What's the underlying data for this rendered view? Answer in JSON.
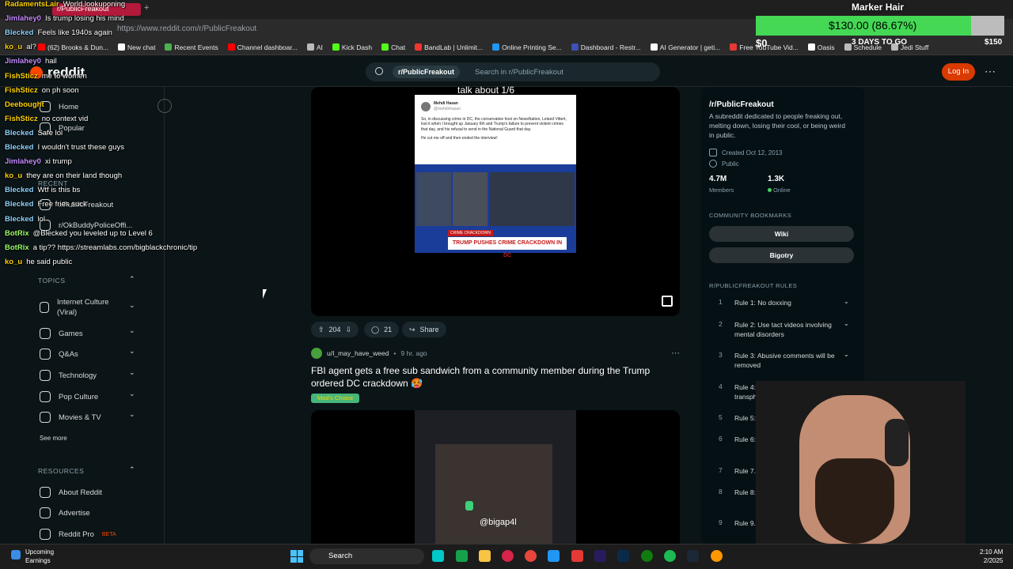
{
  "browser": {
    "tab_title": "r/PublicFreakout",
    "url": "https://www.reddit.com/r/PublicFreakout",
    "bookmarks": [
      {
        "label": "(62) Brooks & Dun...",
        "color": "#ff0000"
      },
      {
        "label": "New chat",
        "color": "#ffffff"
      },
      {
        "label": "Recent Events",
        "color": "#4caf50"
      },
      {
        "label": "Channel dashboar...",
        "color": "#ff0000"
      },
      {
        "label": "AI",
        "color": "#bbbbbb"
      },
      {
        "label": "Kick Dash",
        "color": "#53fc18"
      },
      {
        "label": "Chat",
        "color": "#53fc18"
      },
      {
        "label": "BandLab | Unlimit...",
        "color": "#f0362f"
      },
      {
        "label": "Online Printing Se...",
        "color": "#2196f3"
      },
      {
        "label": "Dashboard - Restr...",
        "color": "#3f51b5"
      },
      {
        "label": "AI Generator | geti...",
        "color": "#ffffff"
      },
      {
        "label": "Free YouTube Vid...",
        "color": "#e53935"
      },
      {
        "label": "Oasis",
        "color": "#ffffff"
      },
      {
        "label": "Schedule",
        "color": "#bbbbbb"
      },
      {
        "label": "Jedi Stuff",
        "color": "#bbbbbb"
      }
    ]
  },
  "header": {
    "logo": "reddit",
    "search_chip": "r/PublicFreakout",
    "search_placeholder": "Search in r/PublicFreakout",
    "login": "Log In"
  },
  "left_nav": {
    "top_items": [
      "Home",
      "Popular"
    ],
    "recent_label": "RECENT",
    "recent_items": [
      "r/PublicFreakout",
      "r/OkBuddyPoliceOffi..."
    ],
    "topics_label": "TOPICS",
    "topics": [
      "Internet Culture (Viral)",
      "Games",
      "Q&As",
      "Technology",
      "Pop Culture",
      "Movies & TV"
    ],
    "see_more": "See more",
    "resources_label": "RESOURCES",
    "resources": [
      "About Reddit",
      "Advertise",
      "Reddit Pro"
    ],
    "reddit_pro_badge": "BETA"
  },
  "post1": {
    "caption": "talk about 1/6",
    "tweet_author": "Mehdi Hasan",
    "tweet_handle": "@mehdirhasan",
    "tweet_text": "So, in discussing crime in DC, the conservative host on NewsNation, Leland Vittert, lost it when I brought up January 6th and Trump's failure to prevent violent crimes that day, and his refusal to send in the National Guard that day.",
    "tweet_text2": "He cut me off and then ended the interview!",
    "tv_banner": "CRIME CRACKDOWN",
    "tv_ticker": "TRUMP PUSHES CRIME CRACKDOWN IN DC",
    "upvotes": "204",
    "comments": "21",
    "share": "Share"
  },
  "post2": {
    "author": "u/I_may_have_weed",
    "time": "9 hr. ago",
    "title": "FBI agent gets a free sub sandwich from a community member during the Trump ordered DC crackdown 🥵",
    "flair": "Mod's Choice",
    "watermark": "@bigap4l"
  },
  "sidebar": {
    "name": "/r/PublicFreakout",
    "description": "A subreddit dedicated to people freaking out, melting down, losing their cool, or being weird in public.",
    "created": "Created Oct 12, 2013",
    "visibility": "Public",
    "members": "4.7M",
    "members_label": "Members",
    "online": "1.3K",
    "online_label": "Online",
    "bookmarks_label": "COMMUNITY BOOKMARKS",
    "bookmarks": [
      "Wiki",
      "Bigotry"
    ],
    "rules_label": "R/PUBLICFREAKOUT RULES",
    "rules": [
      {
        "n": "1",
        "text": "Rule 1: No doxxing"
      },
      {
        "n": "2",
        "text": "Rule 2: Use tact videos involving mental disorders"
      },
      {
        "n": "3",
        "text": "Rule 3: Abusive comments will be removed"
      },
      {
        "n": "4",
        "text": "Rule 4: No racism, sexism, transphobia or bigotry"
      },
      {
        "n": "5",
        "text": "Rule 5: Vid..."
      },
      {
        "n": "6",
        "text": "Rule 6: ... moder..."
      },
      {
        "n": "7",
        "text": "Rule 7..."
      },
      {
        "n": "8",
        "text": "Rule 8: ... death/n..."
      },
      {
        "n": "9",
        "text": "Rule 9... allow..."
      }
    ]
  },
  "stream_goal": {
    "title": "Marker Hair",
    "amount": "$130.00 (86.67%)",
    "progress": 0.8667,
    "min": "$0",
    "days": "3 DAYS TO GO",
    "max": "$150"
  },
  "chat": [
    {
      "user": "RadamentsLair",
      "color": "#ffd400",
      "msg": "World lookuponing"
    },
    {
      "user": "Jimlahey0",
      "color": "#c58cff",
      "msg": "Is trump losing his mind"
    },
    {
      "user": "Blecked",
      "color": "#8fd4ff",
      "msg": "Feels like 1940s again"
    },
    {
      "user": "ko_u",
      "color": "#ffd400",
      "msg": "al?"
    },
    {
      "user": "Jimlahey0",
      "color": "#c58cff",
      "msg": "hail"
    },
    {
      "user": "FishSticz",
      "color": "#ffd400",
      "msg": "me to women"
    },
    {
      "user": "FishSticz",
      "color": "#ffd400",
      "msg": "on ph soon"
    },
    {
      "user": "Deebought",
      "color": "#ffd400",
      "msg": ""
    },
    {
      "user": "FishSticz",
      "color": "#ffd400",
      "msg": "no context vid"
    },
    {
      "user": "Blecked",
      "color": "#8fd4ff",
      "msg": "Safe lol"
    },
    {
      "user": "Blecked",
      "color": "#8fd4ff",
      "msg": "I wouldn't trust these guys"
    },
    {
      "user": "Jimlahey0",
      "color": "#c58cff",
      "msg": "xi trump"
    },
    {
      "user": "ko_u",
      "color": "#ffd400",
      "msg": "they are on their land though"
    },
    {
      "user": "Blecked",
      "color": "#8fd4ff",
      "msg": "Wtf is this bs"
    },
    {
      "user": "Blecked",
      "color": "#8fd4ff",
      "msg": "Free fries suck"
    },
    {
      "user": "Blecked",
      "color": "#8fd4ff",
      "msg": "lol"
    },
    {
      "user": "BotRix",
      "color": "#9bff6b",
      "msg": "@Blecked you leveled up to Level 6"
    },
    {
      "user": "BotRix",
      "color": "#9bff6b",
      "msg": "a tip?? https://streamlabs.com/bigblackchronic/tip"
    },
    {
      "user": "ko_u",
      "color": "#ffd400",
      "msg": "he said public"
    }
  ],
  "taskbar": {
    "weather_title": "Upcoming",
    "weather_sub": "Earnings",
    "search": "Search",
    "time": "2:10 AM",
    "date": "2/2025"
  }
}
